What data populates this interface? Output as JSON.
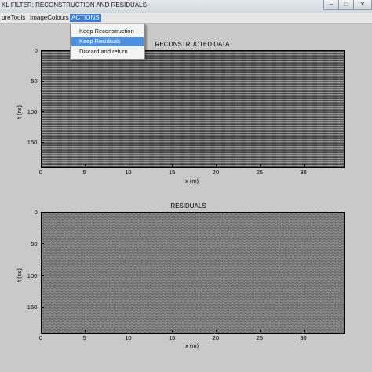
{
  "window": {
    "title": "KL FILTER: RECONSTRUCTION AND RESIDUALS",
    "minimize_glyph": "–",
    "maximize_glyph": "□",
    "close_glyph": "✕"
  },
  "menubar": {
    "items": [
      {
        "label": "ureTools"
      },
      {
        "label": "ImageColours"
      },
      {
        "label": "ACTIONS",
        "active": true
      }
    ]
  },
  "dropdown": {
    "items": [
      {
        "label": "Keep Reconstruction"
      },
      {
        "label": "Keep Residuals",
        "highlighted": true
      },
      {
        "label": "Discard and return"
      }
    ]
  },
  "colors": {
    "menu_active": "#3a7bd5",
    "item_highlight": "#4d90e0",
    "figure_bg": "#c9c9c9"
  },
  "icons": {
    "cursor": "arrow-pointer-icon"
  },
  "plots": [
    {
      "title": "RECONSTRUCTED DATA",
      "xlabel": "x (m)",
      "ylabel": "t (ns)",
      "xticks": [
        "0",
        "5",
        "10",
        "15",
        "20",
        "25",
        "30"
      ],
      "yticks": [
        "0",
        "50",
        "100",
        "150"
      ],
      "xrange": [
        0,
        34.5
      ],
      "yrange": [
        0,
        190
      ]
    },
    {
      "title": "RESIDUALS",
      "xlabel": "x (m)",
      "ylabel": "t (ns)",
      "xticks": [
        "0",
        "5",
        "10",
        "15",
        "20",
        "25",
        "30"
      ],
      "yticks": [
        "0",
        "50",
        "100",
        "150"
      ],
      "xrange": [
        0,
        34.5
      ],
      "yrange": [
        0,
        190
      ]
    }
  ]
}
